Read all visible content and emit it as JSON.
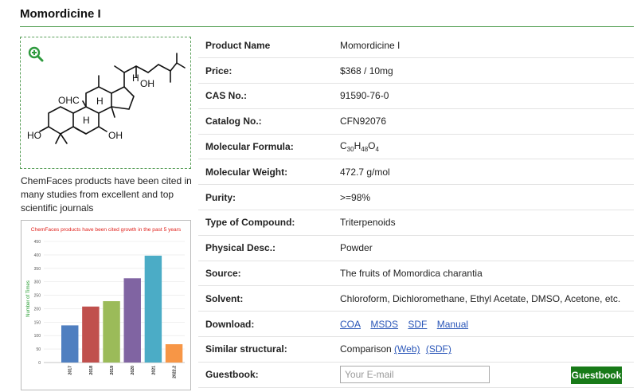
{
  "page": {
    "title": "Momordicine I",
    "cite_text": "ChemFaces products have been cited in many studies from excellent and top scientific journals"
  },
  "structure": {
    "labels": [
      "OHC",
      "HO",
      "OH",
      "OH",
      "H",
      "H",
      "H"
    ]
  },
  "table": {
    "rows": [
      {
        "label": "Product Name",
        "value": "Momordicine I"
      },
      {
        "label": "Price:",
        "value": "$368 / 10mg"
      },
      {
        "label": "CAS No.:",
        "value": "91590-76-0"
      },
      {
        "label": "Catalog No.:",
        "value": "CFN92076"
      },
      {
        "label": "Molecular Formula:",
        "value": ""
      },
      {
        "label": "Molecular Weight:",
        "value": "472.7 g/mol"
      },
      {
        "label": "Purity:",
        "value": ">=98%"
      },
      {
        "label": "Type of Compound:",
        "value": "Triterpenoids"
      },
      {
        "label": "Physical Desc.:",
        "value": "Powder"
      },
      {
        "label": "Source:",
        "value": "The fruits of Momordica charantia"
      },
      {
        "label": "Solvent:",
        "value": "Chloroform, Dichloromethane, Ethyl Acetate, DMSO, Acetone, etc."
      },
      {
        "label": "Download:",
        "value": ""
      },
      {
        "label": "Similar structural:",
        "value": "Comparison"
      },
      {
        "label": "Guestbook:",
        "value": ""
      }
    ],
    "formula": {
      "c": "C",
      "c_n": "30",
      "h": "H",
      "h_n": "48",
      "o": "O",
      "o_n": "4"
    },
    "download_links": [
      "COA",
      "MSDS",
      "SDF",
      "Manual"
    ],
    "similar_links": [
      "(Web)",
      "(SDF)"
    ],
    "email_placeholder": "Your E-mail",
    "guestbook_button": "Guestbook"
  },
  "colors": {
    "accent_green": "#187a18",
    "price_red": "#e0201b",
    "link_blue": "#2a56b8"
  },
  "chart_data": {
    "type": "bar",
    "title": "ChemFaces products have been cited growth in the past 5 years",
    "ylabel": "Number of Times",
    "xlabel": "",
    "categories": [
      "2017",
      "2018",
      "2019",
      "2020",
      "2021",
      "2022.2"
    ],
    "values": [
      138,
      208,
      228,
      313,
      397,
      68
    ],
    "colors": [
      "#4f7fc0",
      "#c0504d",
      "#9bbb59",
      "#8064a2",
      "#4bacc6",
      "#f79646"
    ],
    "yticks": [
      0,
      50,
      100,
      150,
      200,
      250,
      300,
      350,
      400,
      450
    ],
    "ylim": [
      0,
      450
    ]
  }
}
